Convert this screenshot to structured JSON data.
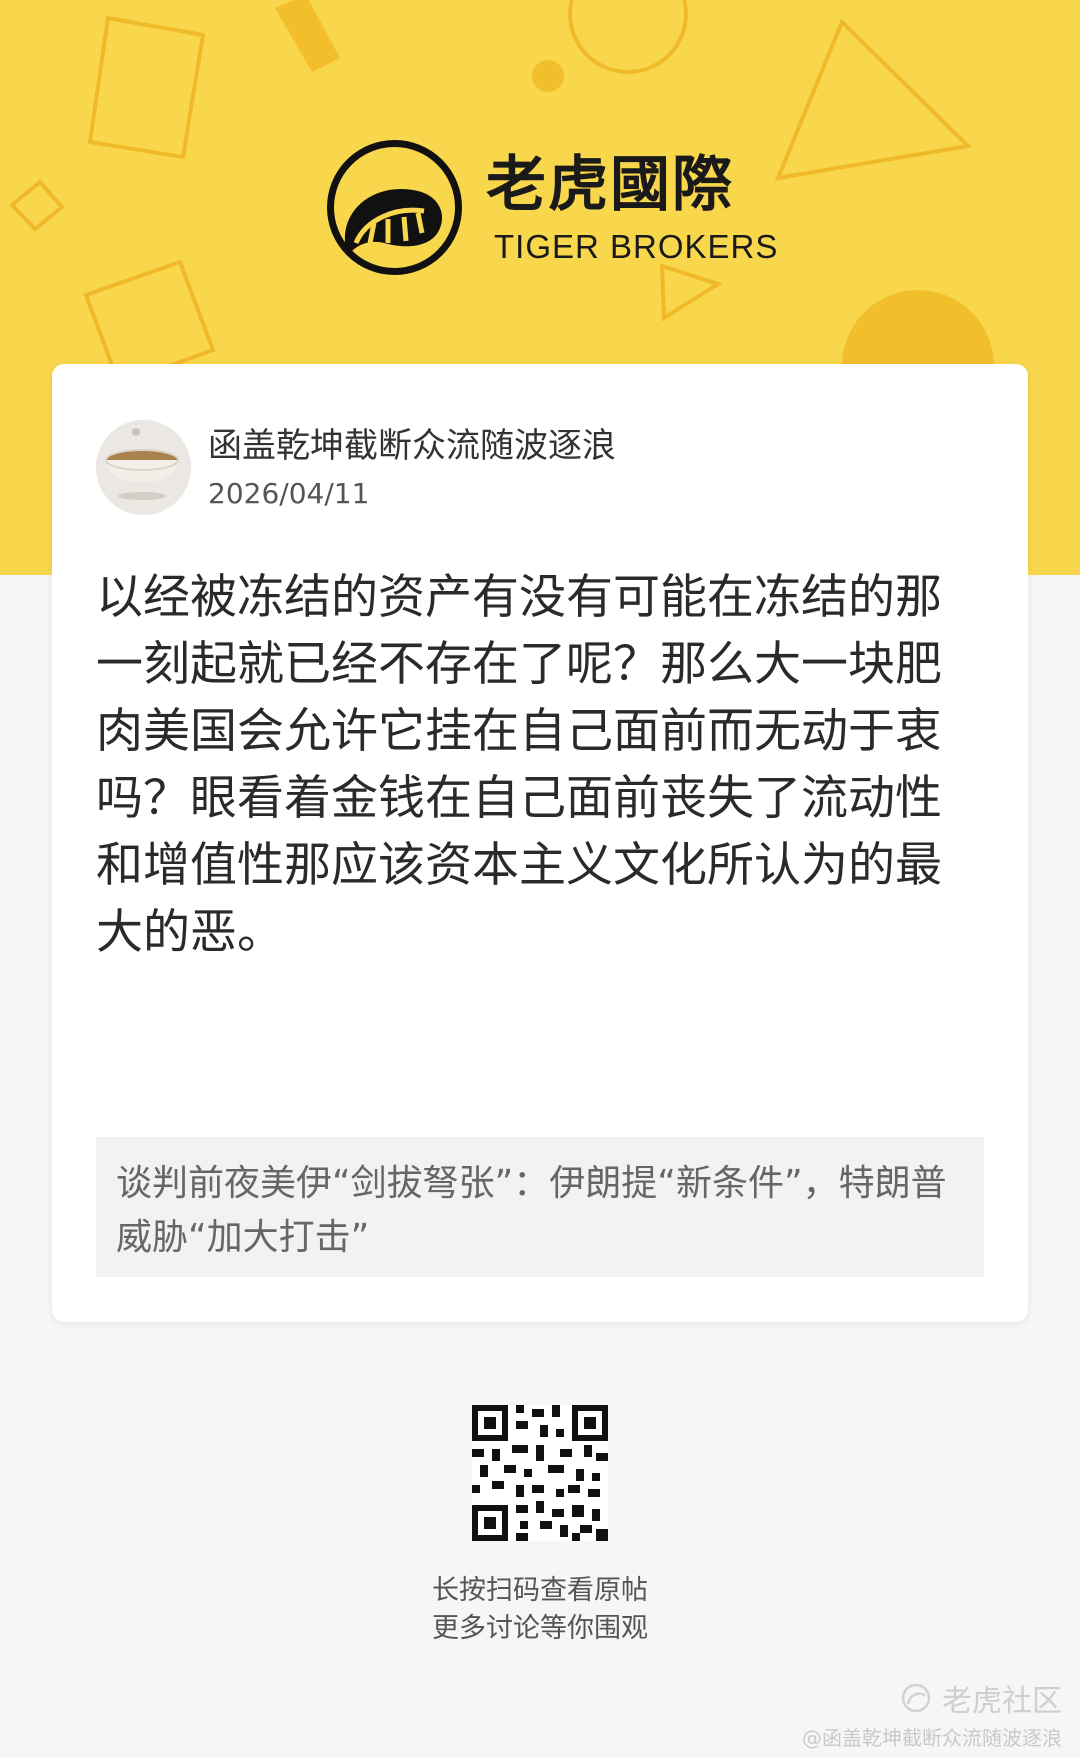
{
  "brand": {
    "name_cn": "老虎國際",
    "name_en": "TIGER BROKERS",
    "logo_icon": "tiger-logo-icon",
    "background_color": "#f8d74c"
  },
  "post": {
    "author_name": "函盖乾坤截断众流随波逐浪",
    "date": "2026/04/11",
    "avatar_icon": "bowl-avatar-icon",
    "content": "以经被冻结的资产有没有可能在冻结的那一刻起就已经不存在了呢？那么大一块肥肉美国会允许它挂在自己面前而无动于衷吗？眼看着金钱在自己面前丧失了流动性和增值性那应该资本主义文化所认为的最大的恶。",
    "related_topic": "谈判前夜美伊“剑拔弩张”：伊朗提“新条件”，特朗普威胁“加大打击”"
  },
  "footer": {
    "qr_icon": "qr-code-icon",
    "line1": "长按扫码查看原帖",
    "line2": "更多讨论等你围观"
  },
  "watermark": {
    "label": "老虎社区",
    "handle": "@函盖乾坤截断众流随波逐浪",
    "icon": "tiger-community-icon"
  }
}
